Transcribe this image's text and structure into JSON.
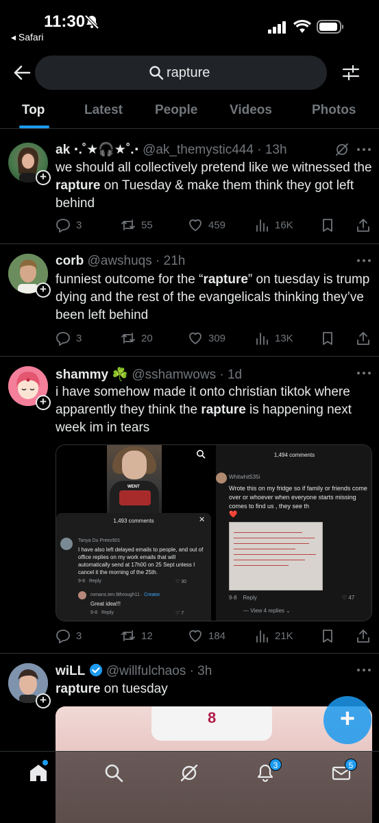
{
  "status_bar": {
    "time": "11:30",
    "back_app": "◂ Safari"
  },
  "search": {
    "query": "rapture"
  },
  "tabs": [
    "Top",
    "Latest",
    "People",
    "Videos",
    "Photos"
  ],
  "tweets": [
    {
      "name": "ak ⋅.˚★🎧★˚.⋅",
      "handle": "@ak_themystic444",
      "time": "· 13h",
      "text_before": "we should all collectively pretend like we witnessed the ",
      "text_bold": "rapture",
      "text_after": " on Tuesday & make them think they got left behind",
      "replies": "3",
      "retweets": "55",
      "likes": "459",
      "views": "16K"
    },
    {
      "name": "corb",
      "handle": "@awshuqs",
      "time": "· 21h",
      "text_before": "funniest outcome for the “",
      "text_bold": "rapture",
      "text_after": "” on tuesday is trump dying and the rest of the evangelicals thinking they’ve been left behind",
      "replies": "3",
      "retweets": "20",
      "likes": "309",
      "views": "13K"
    },
    {
      "name": "shammy ☘️",
      "handle": "@sshamwows",
      "time": "· 1d",
      "text_before": "i have somehow made it onto christian tiktok where apparently they think the ",
      "text_bold": "rapture",
      "text_after": " is happening next week im in tears",
      "replies": "3",
      "retweets": "12",
      "likes": "184",
      "views": "21K",
      "media": {
        "left": {
          "shirt_text": "WENT",
          "comments_title": "1,493 comments",
          "comment1_user": "Tanya Du Preez901",
          "comment1_text": "I have also left delayed emails to people, and out of office replies on my work emails that will automatically send at 17h00 on 25 Sept unless I cancel it the morning of the 25th.",
          "comment1_date": "9-8",
          "comment1_reply": "Reply",
          "comment1_likes": "30",
          "comment2_user": "romans.ten.9through11 · ",
          "comment2_creator": "Creator",
          "comment2_text": "Great idea!!!",
          "comment2_date": "9-8",
          "comment2_reply": "Reply",
          "comment2_likes": "7"
        },
        "right": {
          "comments_title": "1,494 comments",
          "user": "Whitwhit535i",
          "text": "Wrote this on my fridge so if family or friends come over or whoever when everyone starts missing comes to find us , they see th",
          "heart": "❤️",
          "date": "9-8",
          "reply": "Reply",
          "likes": "47",
          "view_replies": "View 4 replies ⌄"
        }
      }
    },
    {
      "name": "wiLL",
      "handle": "@willfulchaos",
      "time": "· 3h",
      "text_before": "",
      "text_bold": "rapture",
      "text_after": " on tuesday",
      "media_number": "8"
    }
  ],
  "bottom_nav": {
    "notifications_badge": "3",
    "messages_badge": "5"
  },
  "colors": {
    "accent": "#1d9bf0",
    "background": "#000000",
    "muted": "#71767b"
  }
}
